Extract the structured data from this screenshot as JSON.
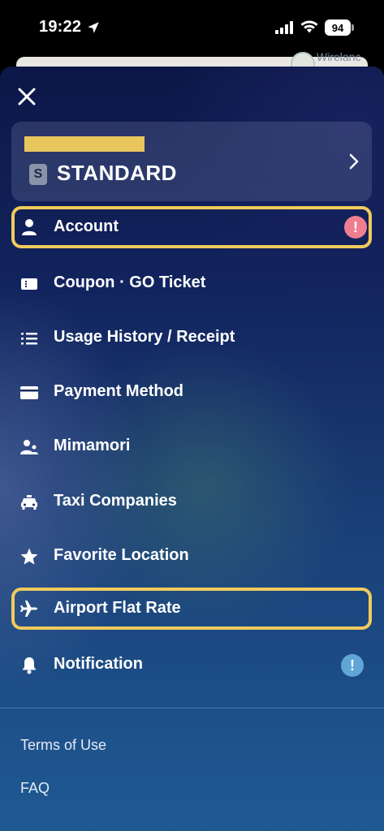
{
  "status": {
    "time": "19:22",
    "battery": "94"
  },
  "map": {
    "peek_text": "Wirelanc"
  },
  "plan": {
    "badge": "S",
    "name": "STANDARD"
  },
  "menu": [
    {
      "label": "Account",
      "icon": "person-icon",
      "alert": "!",
      "alert_color": "#ef7f8f",
      "highlighted": true
    },
    {
      "label": "Coupon · GO Ticket",
      "icon": "ticket-icon"
    },
    {
      "label": "Usage History / Receipt",
      "icon": "list-icon"
    },
    {
      "label": "Payment Method",
      "icon": "card-icon"
    },
    {
      "label": "Mimamori",
      "icon": "people-icon"
    },
    {
      "label": "Taxi Companies",
      "icon": "taxi-icon"
    },
    {
      "label": "Favorite Location",
      "icon": "star-icon"
    },
    {
      "label": "Airport Flat Rate",
      "icon": "airplane-icon",
      "highlighted": true
    },
    {
      "label": "Notification",
      "icon": "bell-icon",
      "alert": "!",
      "alert_color": "#5fa6d6"
    }
  ],
  "footer": {
    "terms": "Terms of Use",
    "faq": "FAQ"
  },
  "colors": {
    "highlight": "#f1cb5b",
    "plan_bar": "#e9c55d"
  }
}
